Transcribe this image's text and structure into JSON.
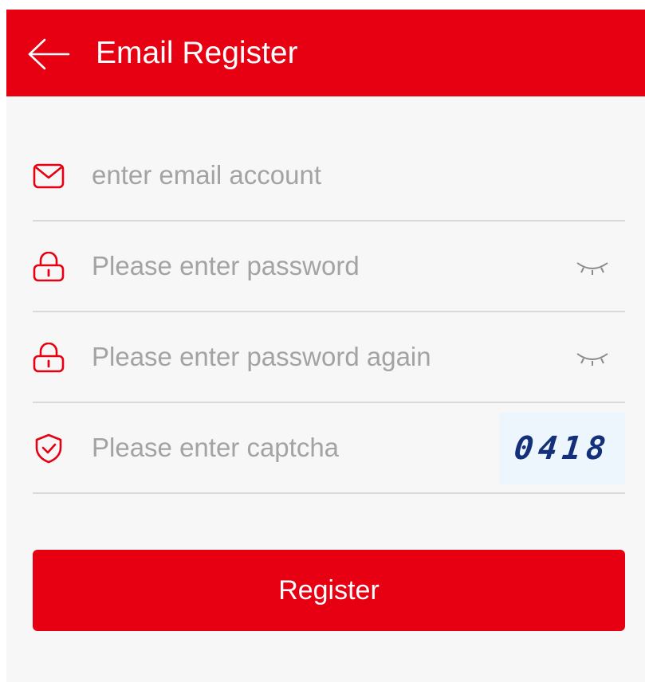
{
  "header": {
    "title": "Email Register",
    "back_icon": "arrow-left-icon",
    "background": "#e60012"
  },
  "form": {
    "email": {
      "placeholder": "enter email account",
      "value": "",
      "icon": "envelope-icon"
    },
    "password": {
      "placeholder": "Please enter password",
      "value": "",
      "icon": "lock-icon",
      "toggle_icon": "eye-closed-icon"
    },
    "password_again": {
      "placeholder": "Please enter password again",
      "value": "",
      "icon": "lock-icon",
      "toggle_icon": "eye-closed-icon"
    },
    "captcha": {
      "placeholder": "Please enter captcha",
      "value": "",
      "icon": "shield-check-icon",
      "image_text": "0418"
    }
  },
  "actions": {
    "register_label": "Register"
  },
  "colors": {
    "accent": "#e60012",
    "placeholder": "#a3a3a3",
    "divider": "#d9d9d9",
    "background": "#f7f7f7"
  }
}
